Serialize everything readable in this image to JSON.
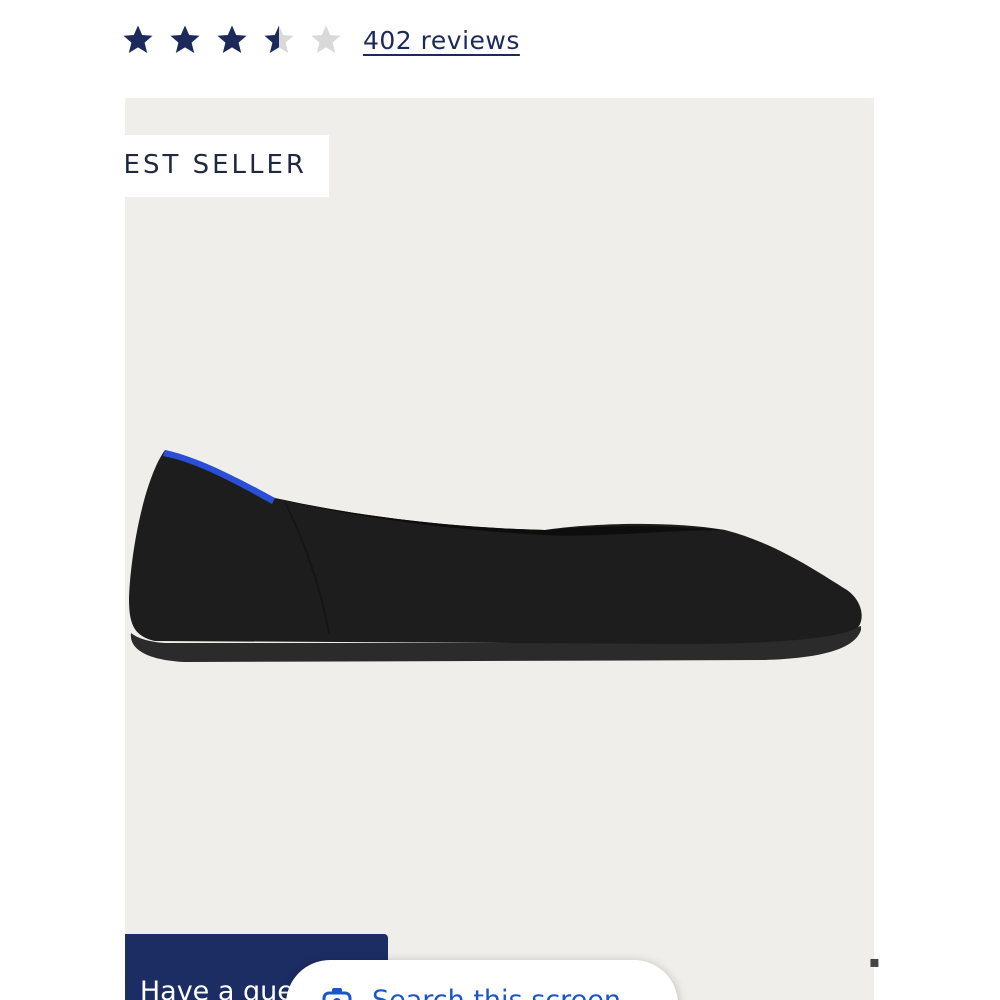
{
  "rating": {
    "value": 3.5,
    "max": 5,
    "reviews_label": "402 reviews",
    "star_color": "#1b2a5b",
    "empty_star_color": "#d9d9d9"
  },
  "product": {
    "badge": "BEST SELLER",
    "accent_color": "#2a4fd6",
    "shoe_color": "#1c1c1c",
    "background_color": "#efeeea"
  },
  "ask_question": {
    "label": "Have a question?",
    "color": "#1c2d64"
  },
  "search_overlay": {
    "label": "Search this screen",
    "icon": "lens-icon",
    "color": "#1a56c9"
  }
}
